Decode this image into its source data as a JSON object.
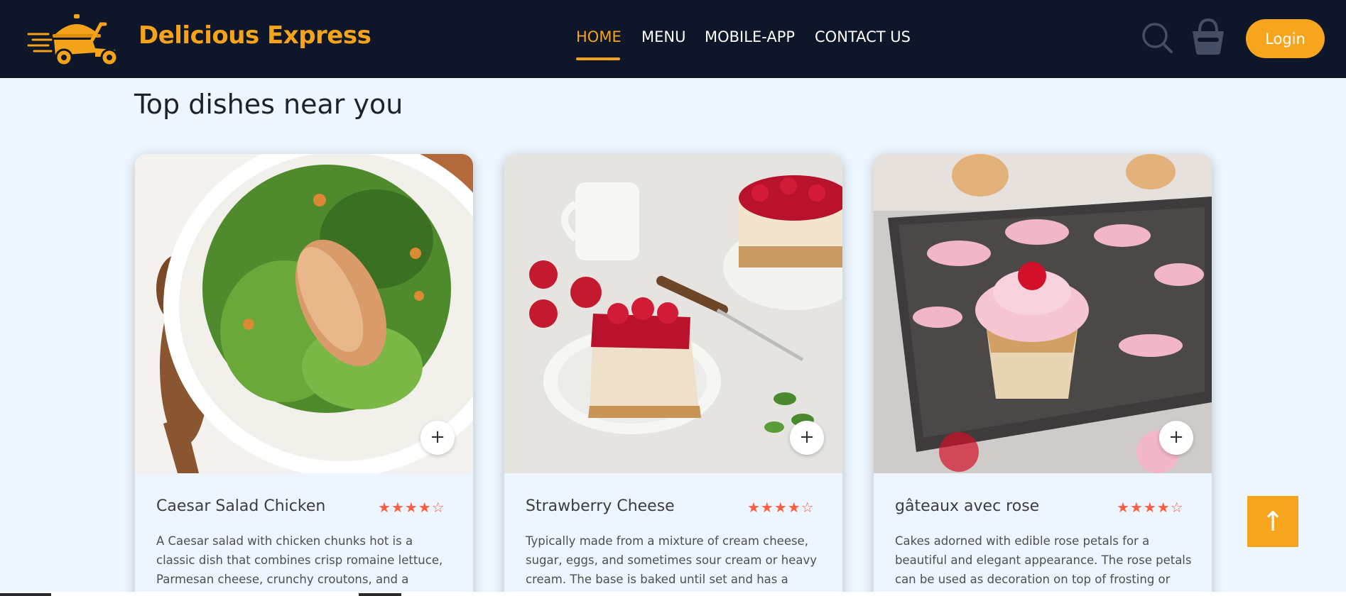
{
  "brand": {
    "name": "Delicious Express",
    "accent": "#f5a31a",
    "header_bg": "#0e1629"
  },
  "nav": {
    "items": [
      {
        "label": "HOME",
        "active": true
      },
      {
        "label": "MENU",
        "active": false
      },
      {
        "label": "MOBILE-APP",
        "active": false
      },
      {
        "label": "CONTACT US",
        "active": false
      }
    ]
  },
  "header_actions": {
    "search_icon": "search-icon",
    "basket_icon": "basket-icon",
    "login_label": "Login"
  },
  "section": {
    "title": "Top dishes near you"
  },
  "dishes": [
    {
      "name": "Caesar Salad Chicken",
      "rating": 4,
      "rating_max": 5,
      "stars": "★★★★☆",
      "add_label": "+",
      "description": "A Caesar salad with chicken chunks hot is a classic dish that combines crisp romaine lettuce, Parmesan cheese, crunchy croutons, and a creamy Caesar"
    },
    {
      "name": "Strawberry Cheese",
      "rating": 4,
      "rating_max": 5,
      "stars": "★★★★☆",
      "add_label": "+",
      "description": "Typically made from a mixture of cream cheese, sugar, eggs, and sometimes sour cream or heavy cream. The base is baked until set and has a smooth,"
    },
    {
      "name": "gâteaux avec rose",
      "rating": 4,
      "rating_max": 5,
      "stars": "★★★★☆",
      "add_label": "+",
      "description": "Cakes adorned with edible rose petals for a beautiful and elegant appearance. The rose petals can be used as decoration on top of frosting or"
    }
  ],
  "scroll_top": {
    "icon": "arrow-up-icon",
    "label": "↑"
  }
}
